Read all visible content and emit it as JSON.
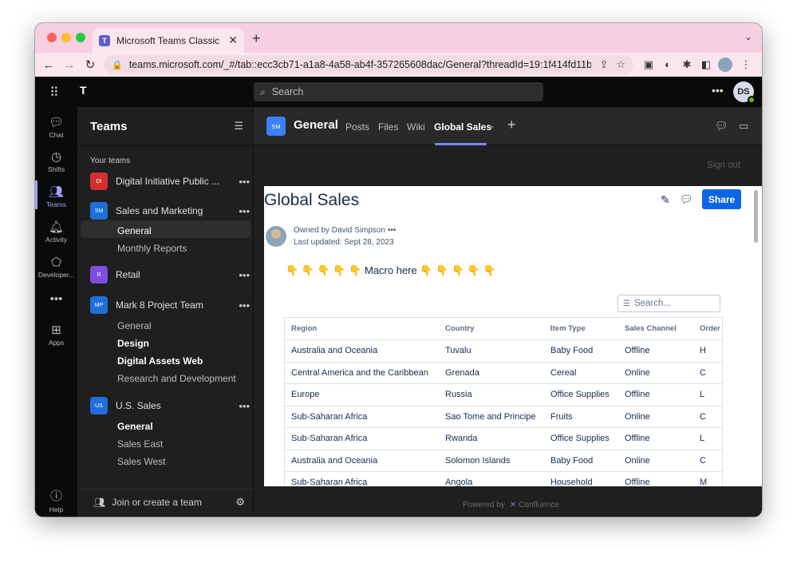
{
  "browser": {
    "tab_title": "Microsoft Teams Classic",
    "url": "teams.microsoft.com/_#/tab::ecc3cb71-a1a8-4a58-ab4f-357265608dac/General?threadId=19:1f414fd11bce4a..."
  },
  "topbar": {
    "search_placeholder": "Search",
    "avatar_initials": "DS"
  },
  "rail": {
    "items": [
      {
        "label": "Chat",
        "icon": "chat-icon"
      },
      {
        "label": "Shifts",
        "icon": "clock-icon"
      },
      {
        "label": "Teams",
        "icon": "teams-icon"
      },
      {
        "label": "Activity",
        "icon": "bell-icon"
      },
      {
        "label": "Developer...",
        "icon": "developer-icon"
      },
      {
        "label": "Apps",
        "icon": "apps-icon"
      },
      {
        "label": "Help",
        "icon": "help-icon"
      }
    ]
  },
  "panel": {
    "title": "Teams",
    "section_label": "Your teams",
    "teams": [
      {
        "badge": "DI",
        "name": "Digital Initiative Public ...",
        "color": "#d32f2f"
      },
      {
        "badge": "SM",
        "name": "Sales and Marketing",
        "color": "#1e6fdb"
      },
      {
        "badge": "R",
        "name": "Retail",
        "color": "#7b4fe0"
      },
      {
        "badge": "MP",
        "name": "Mark 8 Project Team",
        "color": "#1e6fdb"
      },
      {
        "badge": "US",
        "name": "U.S. Sales",
        "color": "#1e6fdb"
      }
    ],
    "channels": {
      "sales_marketing": [
        "General",
        "Monthly Reports"
      ],
      "mark8": [
        "General",
        "Design",
        "Digital Assets Web",
        "Research and Development"
      ],
      "us_sales": [
        "General",
        "Sales East",
        "Sales West"
      ]
    },
    "join_label": "Join or create a team"
  },
  "channel_header": {
    "badge": "SM",
    "title": "General",
    "tabs": [
      "Posts",
      "Files",
      "Wiki",
      "Global Sales"
    ]
  },
  "content": {
    "signout_label": "Sign out",
    "page_title": "Global Sales",
    "share_label": "Share",
    "owner": "Owned by David Simpson",
    "updated": "Last updated: Sept 28, 2023",
    "macro_text": "👇 👇 👇 👇 👇  Macro here 👇 👇 👇 👇 👇",
    "search_placeholder": "Search...",
    "powered_by": "Powered by",
    "powered_brand": "Confluence"
  },
  "table": {
    "headers": [
      "Region",
      "Country",
      "Item Type",
      "Sales Channel",
      "Order"
    ],
    "rows": [
      [
        "Australia and Oceania",
        "Tuvalu",
        "Baby Food",
        "Offline",
        "H"
      ],
      [
        "Central America and the Caribbean",
        "Grenada",
        "Cereal",
        "Online",
        "C"
      ],
      [
        "Europe",
        "Russia",
        "Office Supplies",
        "Offline",
        "L"
      ],
      [
        "Sub-Saharan Africa",
        "Sao Tome and Principe",
        "Fruits",
        "Online",
        "C"
      ],
      [
        "Sub-Saharan Africa",
        "Rwanda",
        "Office Supplies",
        "Offline",
        "L"
      ],
      [
        "Australia and Oceania",
        "Solomon Islands",
        "Baby Food",
        "Online",
        "C"
      ],
      [
        "Sub-Saharan Africa",
        "Angola",
        "Household",
        "Offline",
        "M"
      ]
    ]
  }
}
